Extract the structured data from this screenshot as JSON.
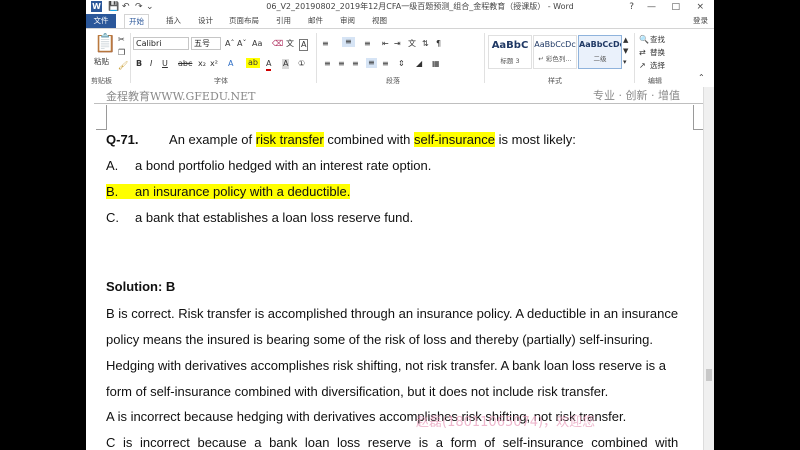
{
  "window": {
    "title": "06_V2_20190802_2019年12月CFA一级百题预测_组合_金程教育（授课版） - Word",
    "app_icon": "W",
    "quick_access": [
      "save-icon",
      "undo-icon",
      "redo-icon",
      "customize-icon"
    ],
    "controls": [
      "?",
      "—",
      "□",
      "×"
    ],
    "login": "登录"
  },
  "tabs": [
    {
      "label": "文件"
    },
    {
      "label": "开始"
    },
    {
      "label": "插入"
    },
    {
      "label": "设计"
    },
    {
      "label": "页面布局"
    },
    {
      "label": "引用"
    },
    {
      "label": "邮件"
    },
    {
      "label": "审阅"
    },
    {
      "label": "视图"
    }
  ],
  "ribbon": {
    "clipboard": {
      "paste": "粘贴",
      "group": "剪贴板"
    },
    "font": {
      "name": "Calibri",
      "size": "五号",
      "group": "字体"
    },
    "paragraph": {
      "group": "段落"
    },
    "styles": {
      "group": "样式",
      "items": [
        {
          "sample": "AaBbC",
          "name": "标题 3"
        },
        {
          "sample": "AaBbCcDc",
          "name": "↵ 彩色列..."
        },
        {
          "sample": "AaBbCcDd",
          "name": "二级"
        }
      ]
    },
    "editing": {
      "find": "查找",
      "replace": "替换",
      "select": "选择",
      "group": "编辑"
    }
  },
  "document": {
    "header_left": "金程教育WWW.GFEDU.NET",
    "header_right": "专业 · 创新 · 增值",
    "question": {
      "number": "Q-71.",
      "pre": "An example of",
      "hl1": "risk transfer",
      "mid": "combined with",
      "hl2": "self-insurance",
      "post": "is most likely:"
    },
    "options": [
      {
        "letter": "A.",
        "text": "a bond portfolio hedged with an interest rate option."
      },
      {
        "letter": "B.",
        "text": "an insurance policy with a deductible."
      },
      {
        "letter": "C.",
        "text": "a bank that establishes a loan loss reserve fund."
      }
    ],
    "solution_title": "Solution: B",
    "solution_lines": [
      "B is correct. Risk transfer is accomplished through an insurance policy. A deductible in an insurance",
      "policy means the insured is bearing some of the risk of loss and thereby (partially) self-insuring.",
      "Hedging with derivatives accomplishes risk shifting, not risk transfer. A bank loan loss reserve is a",
      "form of self-insurance combined with diversification, but it does not include risk transfer.",
      "A is incorrect because hedging with derivatives accomplishes risk shifting, not risk transfer.",
      "C is incorrect because a bank loan loss reserve is a form of self-insurance combined with"
    ],
    "watermark": "赵磊(18011065074)，欢迎您"
  },
  "colors": {
    "word_blue": "#2b579a",
    "highlight": "#ffff00",
    "watermark": "#e9a0bd"
  }
}
